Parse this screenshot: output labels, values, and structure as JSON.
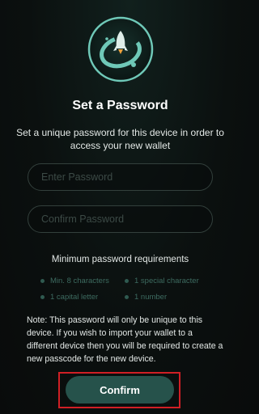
{
  "header": {
    "logo_icon": "safepal-rocket-logo-icon",
    "title": "Set a Password",
    "subtitle": "Set a unique password for this device in order to access your new wallet"
  },
  "form": {
    "password_value": "",
    "password_placeholder": "Enter Password",
    "confirm_value": "",
    "confirm_placeholder": "Confirm Password"
  },
  "requirements": {
    "title": "Minimum password requirements",
    "items": [
      {
        "label": "Min. 8 characters",
        "met": false
      },
      {
        "label": "1 special character",
        "met": false
      },
      {
        "label": "1 capital letter",
        "met": false
      },
      {
        "label": "1 number",
        "met": false
      }
    ]
  },
  "note": "Note: This password will only be unique to this device. If you wish to import your wallet to a different device then you will be required to create a new passcode for the new device.",
  "actions": {
    "confirm_label": "Confirm",
    "highlight_color": "#d01f25"
  },
  "colors": {
    "background": "#0b100f",
    "accent": "#26524b",
    "requirement_text": "#3d6b60"
  }
}
